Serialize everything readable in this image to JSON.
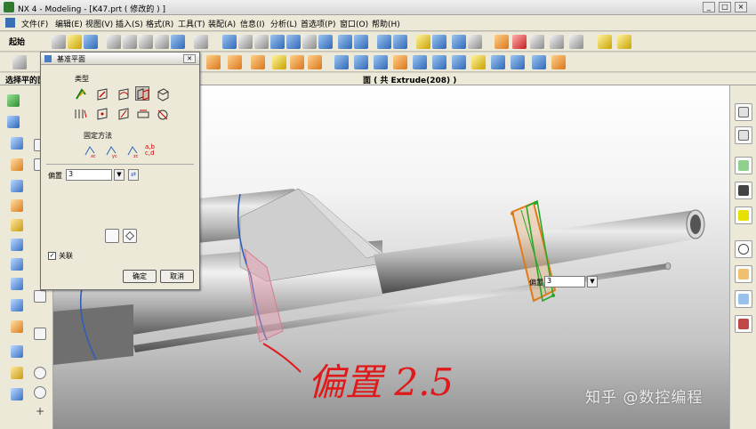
{
  "window": {
    "title": "NX 4 - Modeling - [K47.prt  ( 修改的 ) ]",
    "min_label": "_",
    "max_label": "□",
    "close_label": "×"
  },
  "menu": {
    "items": [
      "文件(F)",
      "编辑(E)",
      "视图(V)",
      "插入(S)",
      "格式(R)",
      "工具(T)",
      "装配(A)",
      "信息(I)",
      "分析(L)",
      "首选项(P)",
      "窗口(O)",
      "帮助(H)"
    ]
  },
  "toolbar": {
    "start_label": "起始"
  },
  "selection_bar": {
    "prompt": "选择平的面",
    "status": "面 ( 共 Extrude(208) )"
  },
  "dialog": {
    "title": "基准平面",
    "type_label": "类型",
    "constraint_label": "固定方法",
    "constraint_abcd": "a,b c,d",
    "offset_label": "偏置",
    "offset_value": "3",
    "associative_label": "关联",
    "associative_check": "✓",
    "ok_label": "确定",
    "cancel_label": "取消"
  },
  "viewport": {
    "offset_label": "偏置",
    "offset_value": "3",
    "annotation": "偏置 2.5",
    "watermark": "知乎 @数控编程"
  },
  "colors": {
    "annotation": "#e01a1a",
    "plane_green": "#2aa82a",
    "plane_orange": "#e07a1a",
    "accent_blue": "#2e5fb8"
  }
}
